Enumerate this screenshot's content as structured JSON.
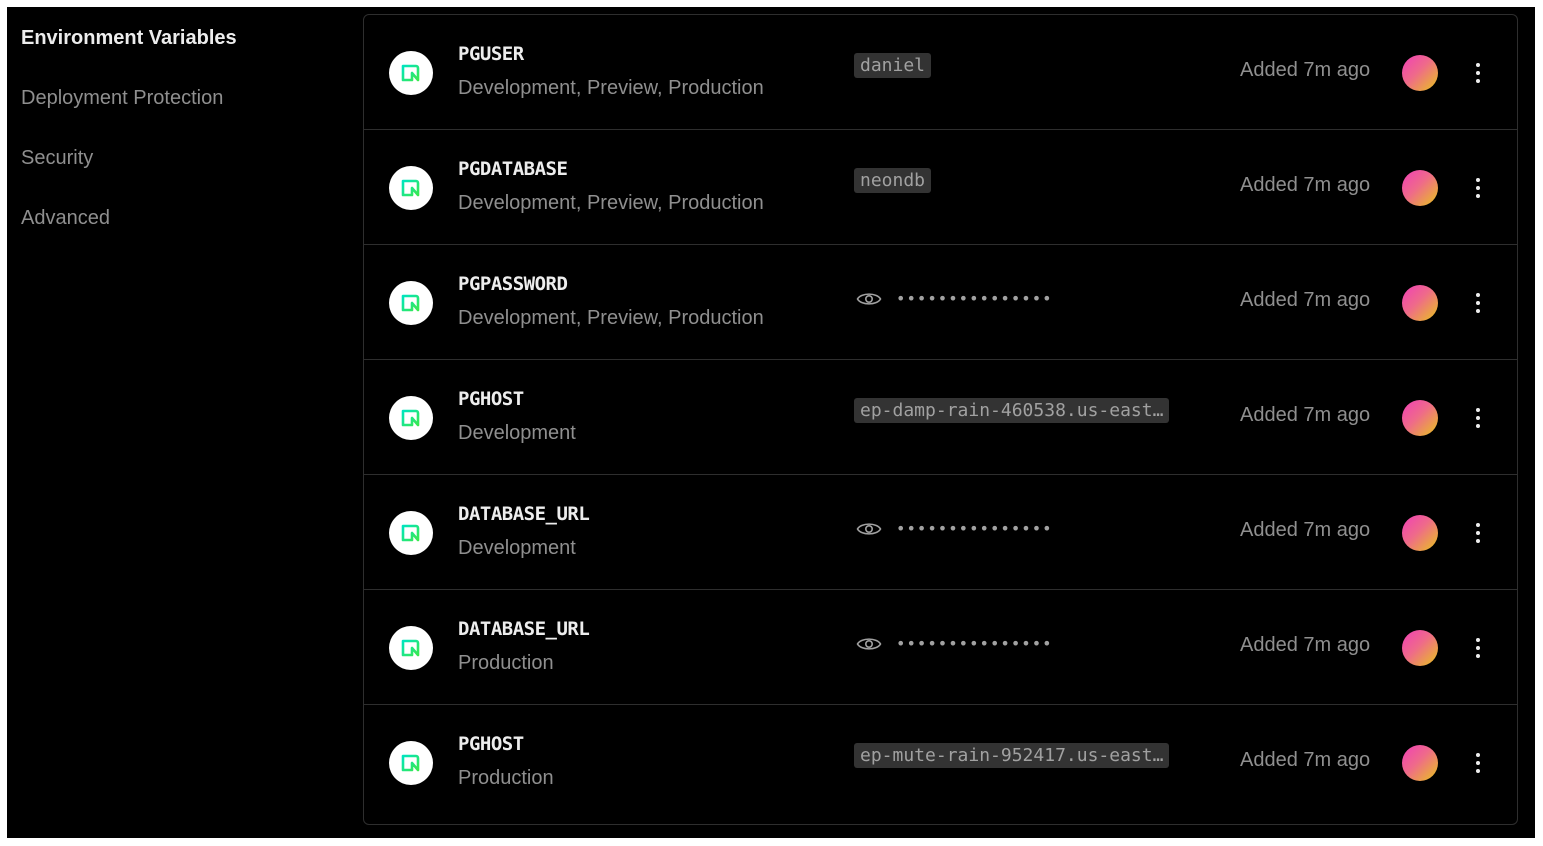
{
  "sidebar": {
    "items": [
      {
        "label": "Environment Variables",
        "active": true
      },
      {
        "label": "Deployment Protection",
        "active": false
      },
      {
        "label": "Security",
        "active": false
      },
      {
        "label": "Advanced",
        "active": false
      }
    ]
  },
  "variables": [
    {
      "name": "PGUSER",
      "environments": "Development, Preview, Production",
      "value": "daniel",
      "hidden": false,
      "added": "Added 7m ago"
    },
    {
      "name": "PGDATABASE",
      "environments": "Development, Preview, Production",
      "value": "neondb",
      "hidden": false,
      "added": "Added 7m ago"
    },
    {
      "name": "PGPASSWORD",
      "environments": "Development, Preview, Production",
      "value": "•••••••••••••••",
      "hidden": true,
      "added": "Added 7m ago"
    },
    {
      "name": "PGHOST",
      "environments": "Development",
      "value": "ep-damp-rain-460538.us-east…",
      "hidden": false,
      "added": "Added 7m ago"
    },
    {
      "name": "DATABASE_URL",
      "environments": "Development",
      "value": "•••••••••••••••",
      "hidden": true,
      "added": "Added 7m ago"
    },
    {
      "name": "DATABASE_URL",
      "environments": "Production",
      "value": "•••••••••••••••",
      "hidden": true,
      "added": "Added 7m ago"
    },
    {
      "name": "PGHOST",
      "environments": "Production",
      "value": "ep-mute-rain-952417.us-east…",
      "hidden": false,
      "added": "Added 7m ago"
    }
  ],
  "icons": {
    "integration": "neon-logo-icon",
    "reveal": "eye-icon",
    "menu": "more-vertical-icon",
    "avatar": "user-avatar"
  },
  "colors": {
    "background": "#000000",
    "text_primary": "#ededed",
    "text_secondary": "#8f8f8f",
    "code_bg": "#333333",
    "border": "#2e2e2e"
  }
}
